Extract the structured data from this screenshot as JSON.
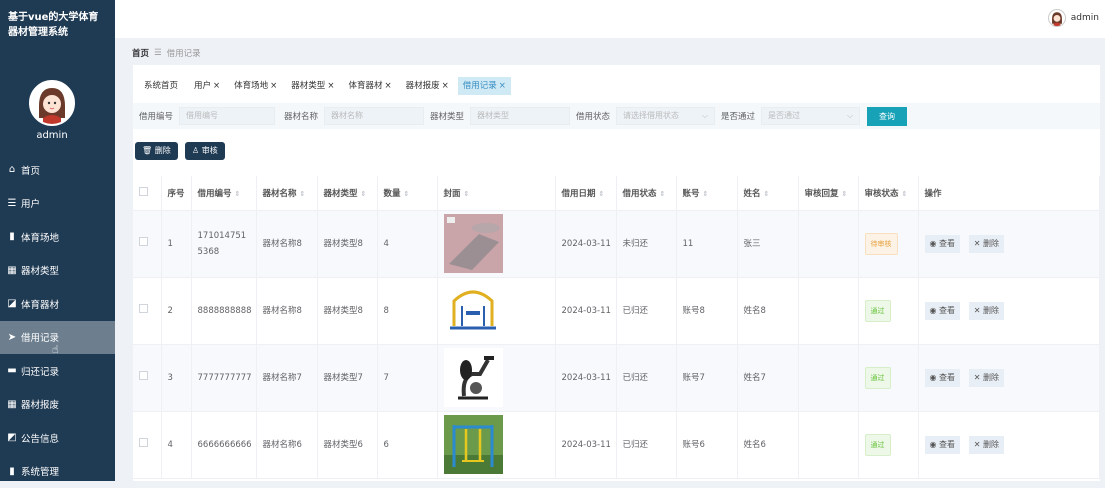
{
  "brand": {
    "line1": "基于vue的大学体育",
    "line2": "器材管理系统"
  },
  "sidebar": {
    "username": "admin",
    "items": [
      {
        "icon": "⌂",
        "label": "首页"
      },
      {
        "icon": "☰",
        "label": "用户"
      },
      {
        "icon": "▮",
        "label": "体育场地"
      },
      {
        "icon": "▦",
        "label": "器材类型"
      },
      {
        "icon": "◪",
        "label": "体育器材"
      },
      {
        "icon": "➤",
        "label": "借用记录"
      },
      {
        "icon": "▬",
        "label": "归还记录"
      },
      {
        "icon": "▦",
        "label": "器材报废"
      },
      {
        "icon": "◩",
        "label": "公告信息"
      },
      {
        "icon": "▮",
        "label": "系统管理"
      }
    ]
  },
  "topbar": {
    "username": "admin"
  },
  "breadcrumb": {
    "home": "首页",
    "sep": "☰",
    "current": "借用记录"
  },
  "tabs": [
    {
      "label": "系统首页",
      "closable": ""
    },
    {
      "label": "用户",
      "closable": "×"
    },
    {
      "label": "体育场地",
      "closable": "×"
    },
    {
      "label": "器材类型",
      "closable": "×"
    },
    {
      "label": "体育器材",
      "closable": "×"
    },
    {
      "label": "器材报废",
      "closable": "×"
    },
    {
      "label": "借用记录",
      "closable": "×"
    }
  ],
  "search": {
    "f1_label": "借用编号",
    "f1_ph": "借用编号",
    "f2_label": "器材名称",
    "f2_ph": "器材名称",
    "f3_label": "器材类型",
    "f3_ph": "器材类型",
    "f4_label": "借用状态",
    "f4_ph": "请选择借用状态",
    "f5_label": "是否通过",
    "f5_ph": "是否通过",
    "query": "查询"
  },
  "actions": {
    "delete": "删除",
    "audit": "审核"
  },
  "table": {
    "headers": [
      "序号",
      "借用编号",
      "器材名称",
      "器材类型",
      "数量",
      "封面",
      "借用日期",
      "借用状态",
      "账号",
      "姓名",
      "审核回复",
      "审核状态",
      "操作"
    ],
    "view_label": "查看",
    "delete_label": "删除",
    "rows": [
      {
        "no": "1",
        "code": "1710147515368",
        "name": "器材名称8",
        "type": "器材类型8",
        "qty": "4",
        "date": "2024-03-11",
        "status": "未归还",
        "account": "11",
        "person": "张三",
        "reply": "",
        "audit": "待审核",
        "audit_kind": "warn",
        "thumb": "mat"
      },
      {
        "no": "2",
        "code": "8888888888",
        "name": "器材名称8",
        "type": "器材类型8",
        "qty": "8",
        "date": "2024-03-11",
        "status": "已归还",
        "account": "账号8",
        "person": "姓名8",
        "reply": "",
        "audit": "通过",
        "audit_kind": "ok",
        "thumb": "frame"
      },
      {
        "no": "3",
        "code": "7777777777",
        "name": "器材名称7",
        "type": "器材类型7",
        "qty": "7",
        "date": "2024-03-11",
        "status": "已归还",
        "account": "账号7",
        "person": "姓名7",
        "reply": "",
        "audit": "通过",
        "audit_kind": "ok",
        "thumb": "bike"
      },
      {
        "no": "4",
        "code": "6666666666",
        "name": "器材名称6",
        "type": "器材类型6",
        "qty": "6",
        "date": "2024-03-11",
        "status": "已归还",
        "account": "账号6",
        "person": "姓名6",
        "reply": "",
        "audit": "通过",
        "audit_kind": "ok",
        "thumb": "outdoor"
      }
    ]
  }
}
